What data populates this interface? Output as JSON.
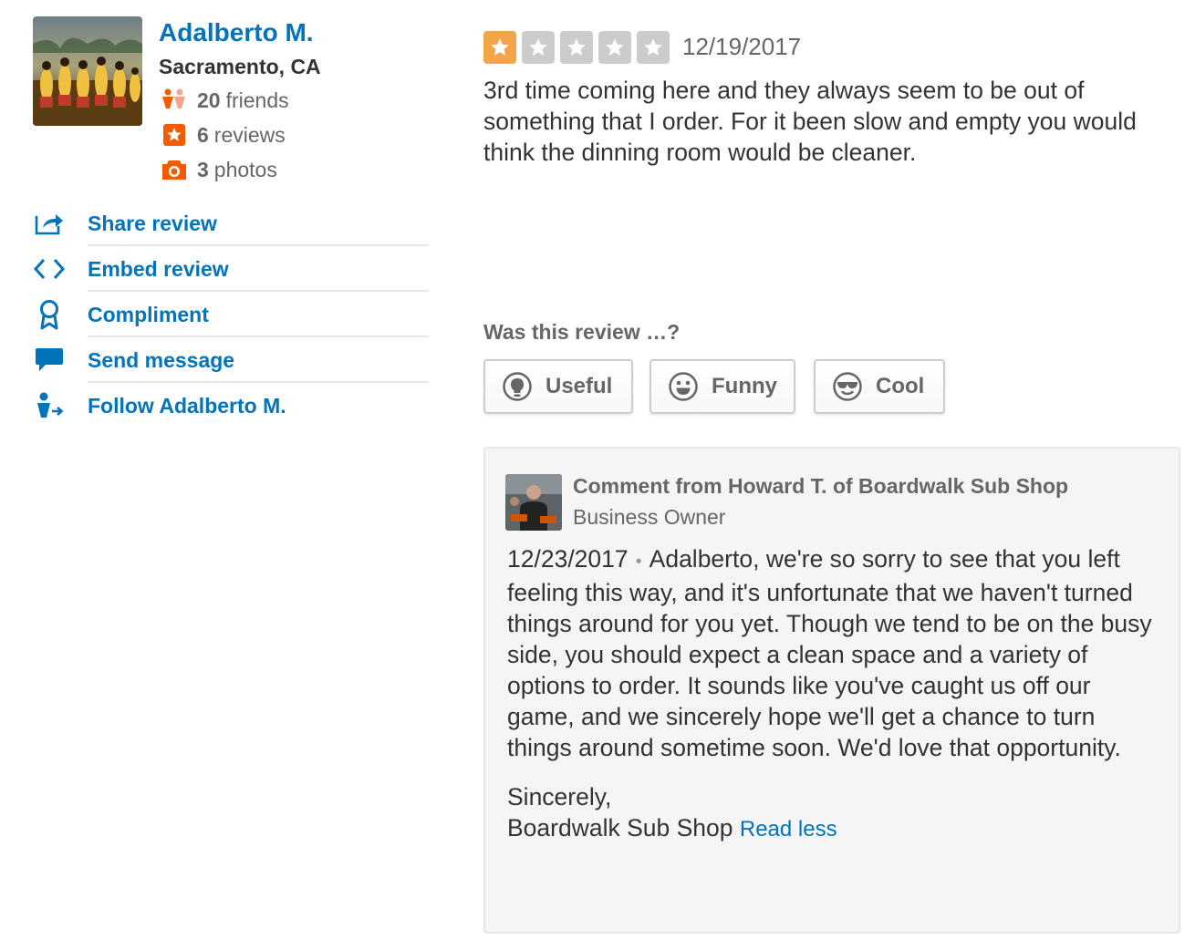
{
  "user": {
    "name": "Adalberto M.",
    "location": "Sacramento, CA",
    "friends_count": "20",
    "friends_label": "friends",
    "reviews_count": "6",
    "reviews_label": "reviews",
    "photos_count": "3",
    "photos_label": "photos"
  },
  "actions": [
    {
      "label": "Share review",
      "icon": "share-icon"
    },
    {
      "label": "Embed review",
      "icon": "embed-code-icon"
    },
    {
      "label": "Compliment",
      "icon": "award-ribbon-icon"
    },
    {
      "label": "Send message",
      "icon": "speech-bubble-icon"
    },
    {
      "label": "Follow Adalberto M.",
      "icon": "follow-user-icon"
    }
  ],
  "review": {
    "rating": 1,
    "max_rating": 5,
    "date": "12/19/2017",
    "text": "3rd time coming here and they always seem to be out of something that I order. For it been slow and empty you would think the dinning room would be cleaner."
  },
  "votes": {
    "prompt": "Was this review …?",
    "useful_label": "Useful",
    "funny_label": "Funny",
    "cool_label": "Cool"
  },
  "comment": {
    "title": "Comment from Howard T. of Boardwalk Sub Shop",
    "role": "Business Owner",
    "date": "12/23/2017",
    "body": "Adalberto, we're so sorry to see that you left feeling this way, and it's unfortunate that we haven't turned things around for you yet. Though we tend to be on the busy side, you should expect a clean space and a variety of options to order. It sounds like you've caught us off our game, and we sincerely hope we'll get a chance to turn things around sometime soon. We'd love that opportunity.",
    "sign_off": "Sincerely,",
    "signature": "Boardwalk Sub Shop",
    "read_less": "Read less"
  },
  "colors": {
    "link": "#0073bb",
    "star_on": "#f5a549",
    "star_off": "#cccccc",
    "icon_orange": "#f15c00"
  }
}
